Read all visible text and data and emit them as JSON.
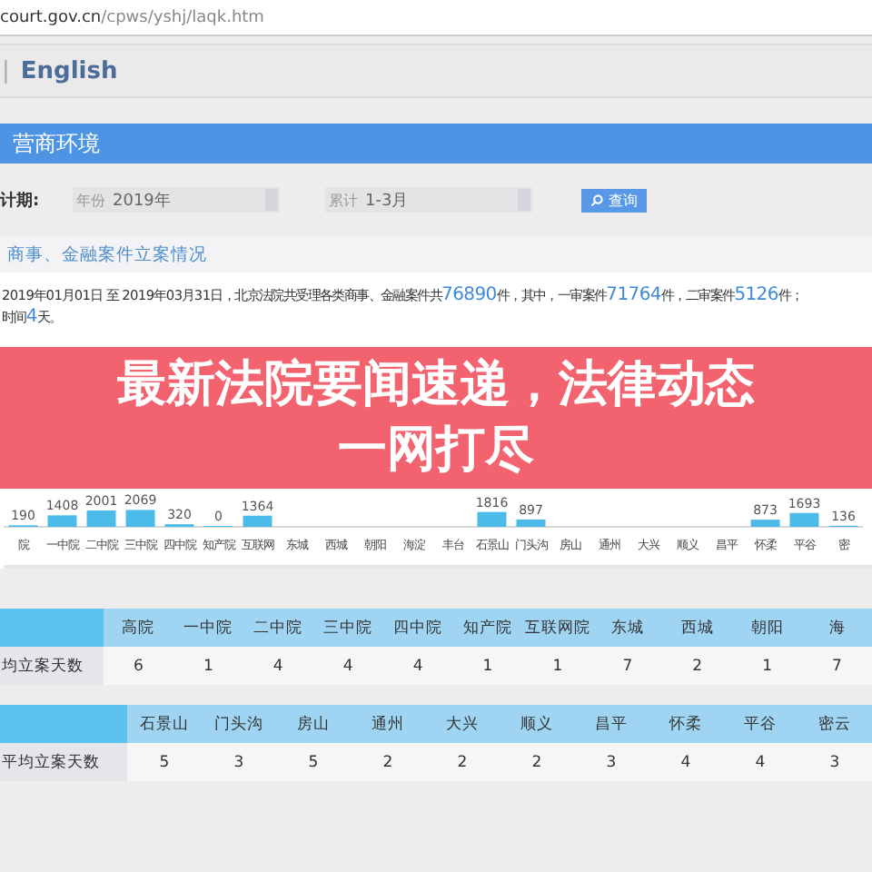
{
  "address_bar": {
    "host": "court.gov.cn",
    "path": "/cpws/yshj/laqk.htm"
  },
  "header": {
    "separator": "|",
    "language_link": "English"
  },
  "nav_bar": {
    "title": "营商环境"
  },
  "filter": {
    "label": "计期:",
    "year_field": {
      "prefix": "年份",
      "value": "2019年"
    },
    "period_field": {
      "prefix": "累计",
      "value": "1-3月"
    },
    "search_button": "查询"
  },
  "section": {
    "title": "商事、金融案件立案情况",
    "summary": [
      "2019年01月01日 至 2019年03月31日，北京法院共受理各类商事、金融案件共**76890**件，其中，一审案件**71764**件，二审案件**5126**件；",
      "时间**4**天。"
    ],
    "chart_data": {
      "type": "bar",
      "categories": [
        "院",
        "一中院",
        "二中院",
        "三中院",
        "四中院",
        "知产院",
        "互联网",
        "东城",
        "西城",
        "朝阳",
        "海淀",
        "丰台",
        "石景山",
        "门头沟",
        "房山",
        "通州",
        "大兴",
        "顺义",
        "昌平",
        "怀柔",
        "平谷",
        "密"
      ],
      "series": [
        {
          "color": "#4dbbea",
          "values": [
            190,
            1408,
            2001,
            2069,
            320,
            0,
            1364,
            null,
            null,
            null,
            null,
            null,
            1816,
            897,
            null,
            null,
            null,
            null,
            null,
            873,
            1693,
            136
          ]
        }
      ],
      "data_labels": true
    }
  },
  "banner": {
    "headline": "最新法院要闻速递，法律动态一网打尽"
  },
  "tables": [
    {
      "columns": [
        "高院",
        "一中院",
        "二中院",
        "三中院",
        "四中院",
        "知产院",
        "互联网院",
        "东城",
        "西城",
        "朝阳",
        "海"
      ],
      "rows": [
        {
          "label": "均立案天数",
          "values": [
            "6",
            "1",
            "4",
            "4",
            "4",
            "1",
            "1",
            "7",
            "2",
            "1",
            "7"
          ]
        }
      ]
    },
    {
      "columns": [
        "石景山",
        "门头沟",
        "房山",
        "通州",
        "大兴",
        "顺义",
        "昌平",
        "怀柔",
        "平谷",
        "密云"
      ],
      "rows": [
        {
          "label": "平均立案天数",
          "values": [
            "5",
            "3",
            "5",
            "2",
            "2",
            "2",
            "3",
            "4",
            "4",
            "3"
          ]
        }
      ]
    }
  ]
}
